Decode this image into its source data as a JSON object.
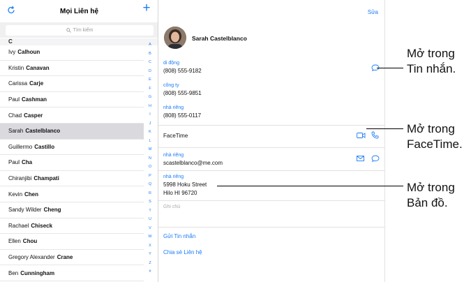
{
  "left": {
    "title": "Mọi Liên hệ",
    "search_placeholder": "Tìm kiếm",
    "section": "C",
    "contacts": [
      {
        "first": "Ivy",
        "last": "Calhoun"
      },
      {
        "first": "Kristin",
        "last": "Canavan"
      },
      {
        "first": "Carissa",
        "last": "Carje"
      },
      {
        "first": "Paul",
        "last": "Cashman"
      },
      {
        "first": "Chad",
        "last": "Casper"
      },
      {
        "first": "Sarah",
        "last": "Castelblanco"
      },
      {
        "first": "Guillermo",
        "last": "Castillo"
      },
      {
        "first": "Paul",
        "last": "Cha"
      },
      {
        "first": "Chiranjibi",
        "last": "Champati"
      },
      {
        "first": "Kevin",
        "last": "Chen"
      },
      {
        "first": "Sandy Wilder",
        "last": "Cheng"
      },
      {
        "first": "Rachael",
        "last": "Chiseck"
      },
      {
        "first": "Ellen",
        "last": "Chou"
      },
      {
        "first": "Gregory Alexander",
        "last": "Crane"
      },
      {
        "first": "Ben",
        "last": "Cunningham"
      }
    ],
    "selected_index": 5,
    "index_letters": [
      "A",
      "B",
      "C",
      "D",
      "E",
      "F",
      "G",
      "H",
      "I",
      "J",
      "K",
      "L",
      "M",
      "N",
      "O",
      "P",
      "Q",
      "R",
      "S",
      "T",
      "U",
      "V",
      "W",
      "X",
      "Y",
      "Z",
      "#"
    ]
  },
  "detail": {
    "edit_label": "Sửa",
    "name": "Sarah Castelblanco",
    "mobile_label": "di động",
    "mobile_value": "(808) 555-9182",
    "work_label": "công ty",
    "work_value": "(808) 555-9851",
    "home_label": "nhà riêng",
    "home_value": "(808) 555-0117",
    "facetime_label": "FaceTime",
    "email_label": "nhà riêng",
    "email_value": "scastelblanco@me.com",
    "address_label": "nhà riêng",
    "address_line1": "5998 Hoku Street",
    "address_line2": "Hilo HI 96720",
    "notes_label": "Ghi chú",
    "send_message": "Gửi Tin nhắn",
    "share_contact": "Chia sẻ Liên hệ",
    "accent_color": "#1a7cf6"
  },
  "callouts": {
    "messages": [
      "Mở trong",
      "Tin nhắn."
    ],
    "facetime": [
      "Mở trong",
      "FaceTime."
    ],
    "maps": [
      "Mở trong",
      "Bản đồ."
    ]
  }
}
